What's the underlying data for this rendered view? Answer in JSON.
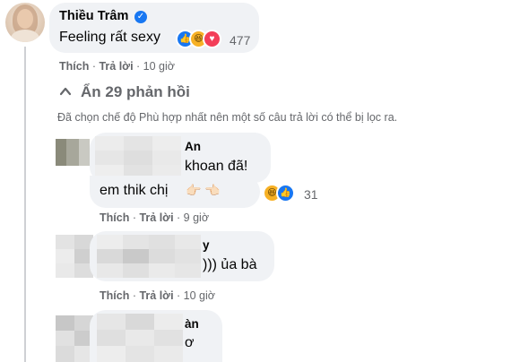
{
  "main_comment": {
    "author": "Thiều Trâm",
    "verified_icon": "verified-check-icon",
    "text": "Feeling rất sexy",
    "reactions": [
      "like-icon",
      "haha-icon",
      "love-icon"
    ],
    "reaction_count": "477",
    "actions": {
      "like": "Thích",
      "reply": "Trả lời",
      "time": "10 giờ"
    }
  },
  "replies_toggle": {
    "icon": "chevron-up-icon",
    "label": "Ẩn 29 phản hồi"
  },
  "filter_notice": "Đã chọn chế độ Phù hợp nhất nên một số câu trả lời có thể bị lọc ra.",
  "replies": [
    {
      "author_partial": "An",
      "lines": [
        "khoan đã!",
        "em thik chị"
      ],
      "reactions": [
        "haha-icon",
        "like-icon"
      ],
      "reaction_count": "31",
      "actions": {
        "like": "Thích",
        "reply": "Trả lời",
        "time": "9 giờ"
      }
    },
    {
      "author_partial": "y",
      "lines": [
        "))) ủa bà"
      ],
      "actions": {
        "like": "Thích",
        "reply": "Trả lời",
        "time": "10 giờ"
      }
    },
    {
      "author_partial": "àn",
      "lines": [
        "ơ"
      ]
    }
  ],
  "colors": {
    "bubble": "#f0f2f5",
    "secondary_text": "#65676b",
    "brand_blue": "#1877f2",
    "love_red": "#f33e58",
    "haha_yellow": "#f7b125"
  }
}
